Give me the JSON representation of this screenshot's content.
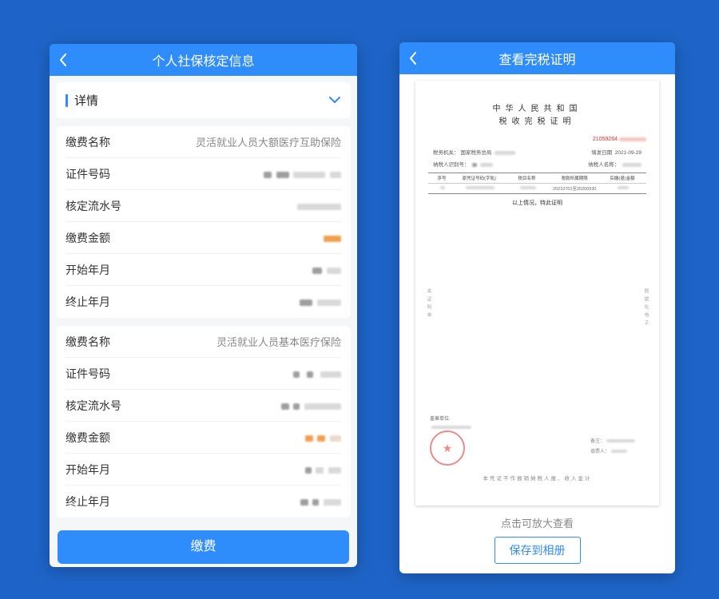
{
  "left": {
    "appbar_title": "个人社保核定信息",
    "details_title": "详情",
    "card1": {
      "name_label": "缴费名称",
      "name_value": "灵活就业人员大额医疗互助保险",
      "id_label": "证件号码",
      "serial_label": "核定流水号",
      "amount_label": "缴费金额",
      "start_label": "开始年月",
      "end_label": "终止年月"
    },
    "card2": {
      "name_label": "缴费名称",
      "name_value": "灵活就业人员基本医疗保险",
      "id_label": "证件号码",
      "serial_label": "核定流水号",
      "amount_label": "缴费金额",
      "start_label": "开始年月",
      "end_label": "终止年月"
    },
    "pay_button": "缴费"
  },
  "right": {
    "appbar_title": "查看完税证明",
    "cert": {
      "title_line1": "中华人民共和国",
      "title_line2": "税收完税证明",
      "doc_no_prefix": "21059264",
      "meta_l1_left_label": "税务机关：",
      "meta_l1_left_value": "国家税务总局",
      "meta_l1_right_label": "填发日期",
      "meta_l1_right_value": "2021-09-29",
      "meta_l2_left_label": "纳税人识别号：",
      "meta_l2_right_label": "纳税人名称：",
      "table_h1": "序号",
      "table_h2": "原凭证号码(字轨)",
      "table_h3": "税目名称",
      "table_h4": "税款所属期限",
      "table_h5": "实缴(退)金额",
      "table_d4": "20210701至20200930",
      "statement": "以上情况，特此证明",
      "side_left": "本证明单",
      "side_right": "数据化电子",
      "seal_label": "盖章单位:",
      "right_block_l1": "备注：",
      "right_block_l2": "填票人：",
      "footer_line": "本凭证不作报销纳税人报、收入金计"
    },
    "zoom_hint": "点击可放大查看",
    "save_button": "保存到相册"
  }
}
